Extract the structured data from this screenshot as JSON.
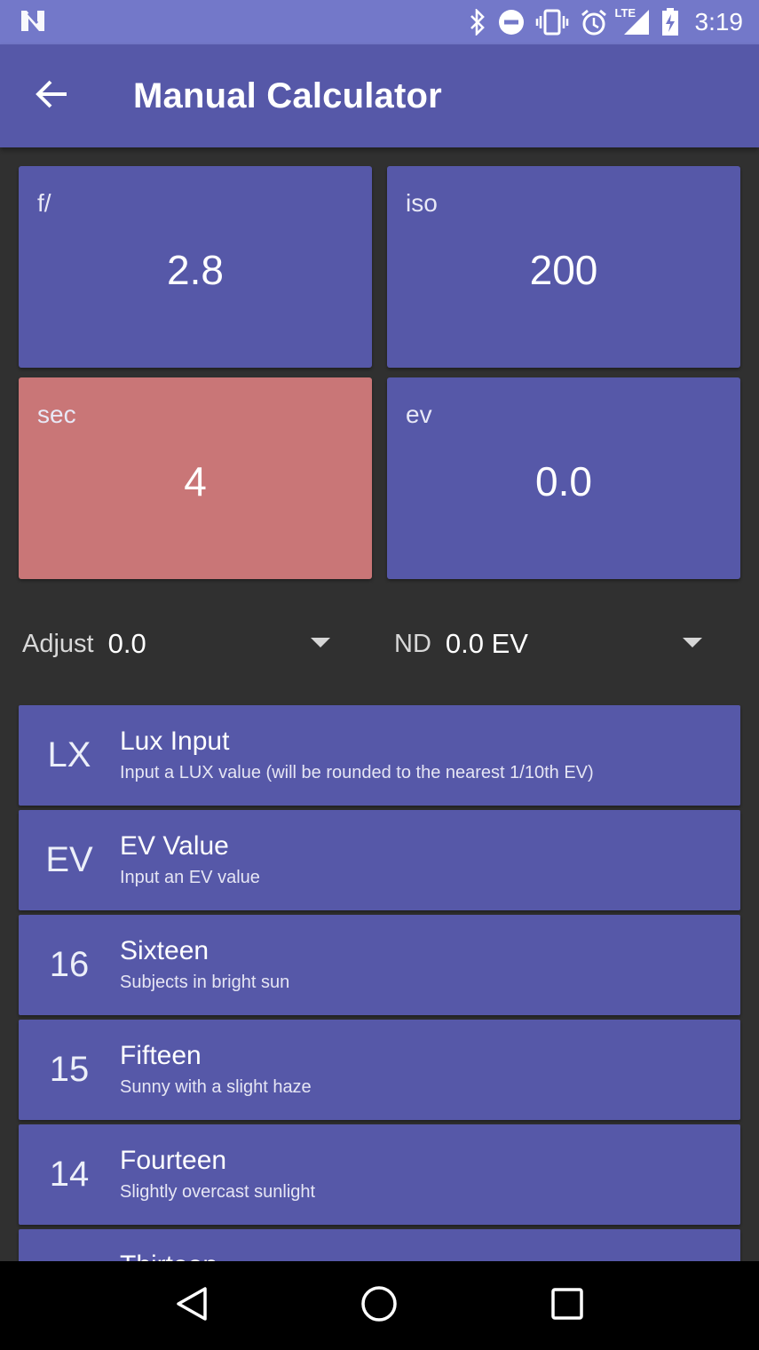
{
  "status_bar": {
    "time": "3:19",
    "network_label": "LTE",
    "icons": [
      "n-notification-icon",
      "bluetooth-icon",
      "do-not-disturb-icon",
      "vibrate-icon",
      "alarm-icon",
      "signal-icon",
      "battery-charging-icon"
    ]
  },
  "app_bar": {
    "title": "Manual Calculator",
    "back_icon": "arrow-back-icon"
  },
  "tiles": {
    "aperture": {
      "label": "f/",
      "value": "2.8"
    },
    "iso": {
      "label": "iso",
      "value": "200"
    },
    "shutter": {
      "label": "sec",
      "value": "4"
    },
    "ev": {
      "label": "ev",
      "value": "0.0"
    }
  },
  "adjust": {
    "label": "Adjust",
    "value": "0.0"
  },
  "nd": {
    "label": "ND",
    "value": "0.0 EV"
  },
  "list": [
    {
      "icon": "LX",
      "title": "Lux Input",
      "subtitle": "Input a LUX value (will be rounded to the nearest 1/10th EV)"
    },
    {
      "icon": "EV",
      "title": "EV Value",
      "subtitle": "Input an EV value"
    },
    {
      "icon": "16",
      "title": "Sixteen",
      "subtitle": "Subjects in bright sun"
    },
    {
      "icon": "15",
      "title": "Fifteen",
      "subtitle": "Sunny with a slight haze"
    },
    {
      "icon": "14",
      "title": "Fourteen",
      "subtitle": "Slightly overcast sunlight"
    },
    {
      "icon": "",
      "title": "Thirteen",
      "subtitle": ""
    }
  ],
  "nav_bar": {
    "icons": [
      "nav-back-icon",
      "nav-home-icon",
      "nav-recents-icon"
    ]
  },
  "colors": {
    "primary": "#5658a8",
    "status_bar": "#7378c9",
    "highlight_tile": "#c97677",
    "background": "#303030"
  }
}
